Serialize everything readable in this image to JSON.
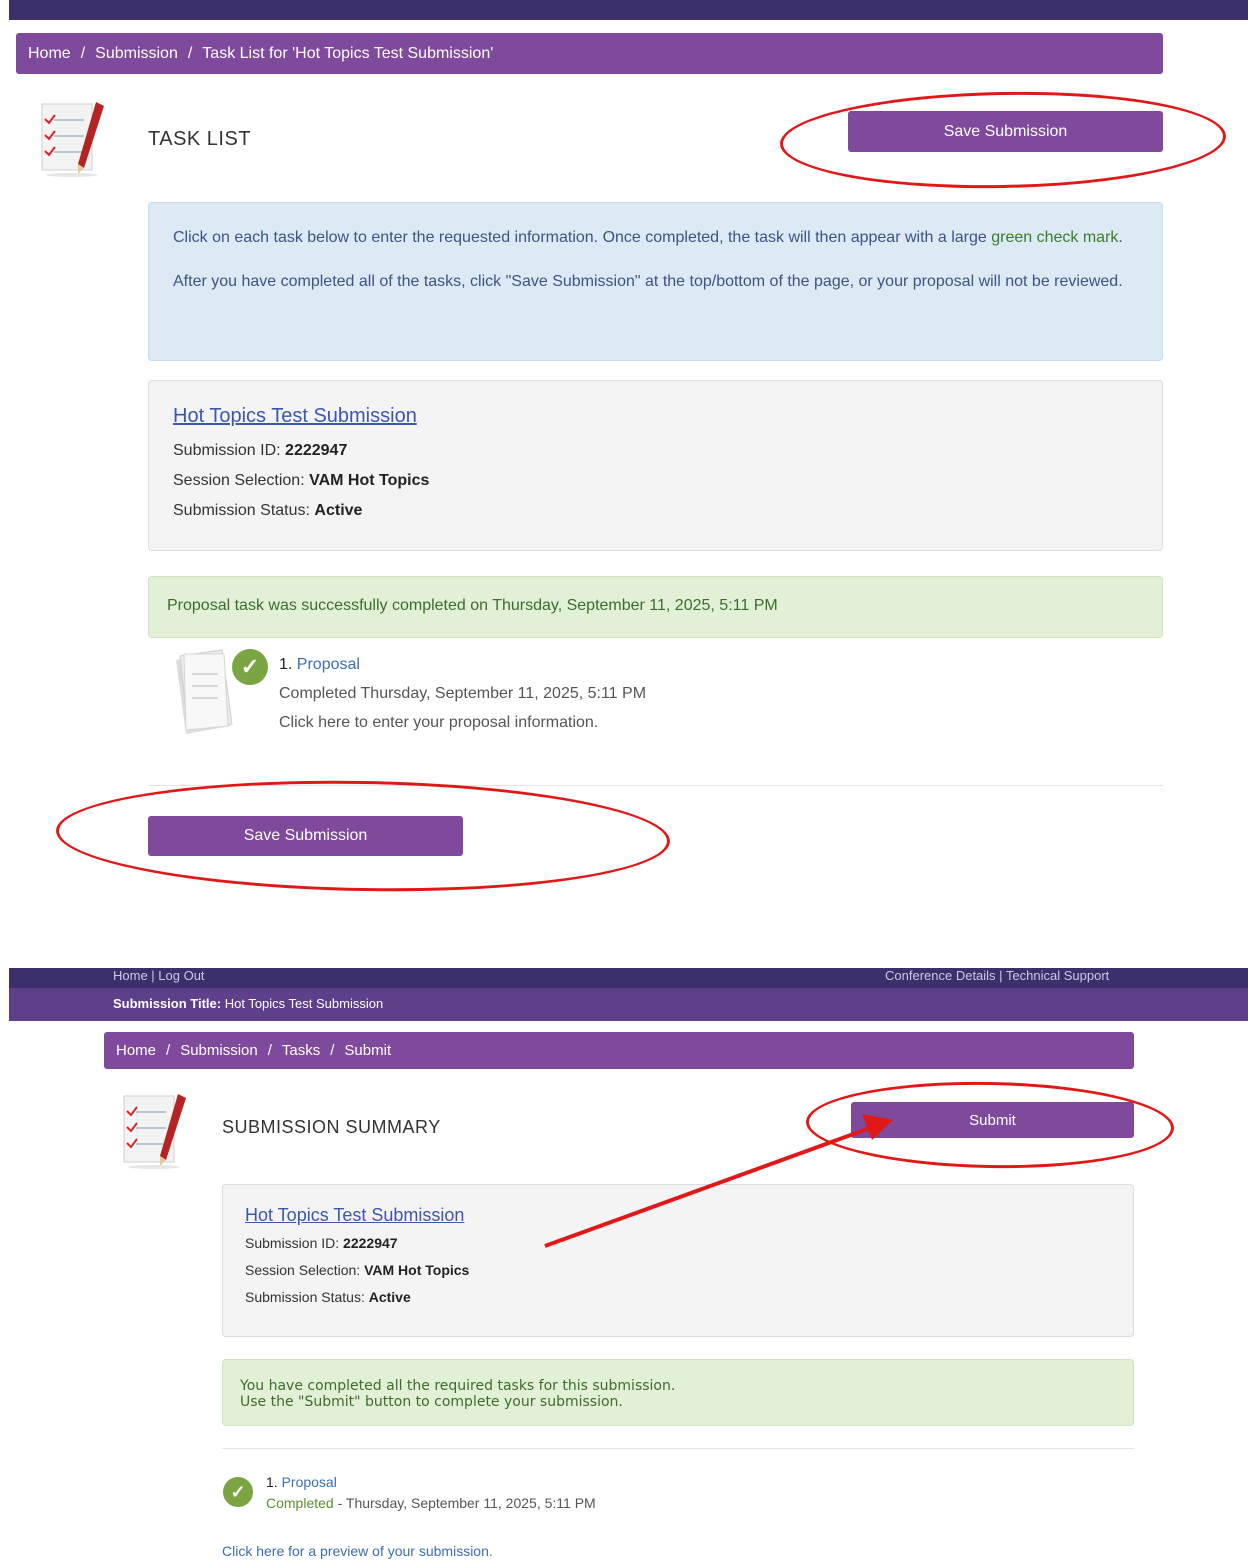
{
  "panel1": {
    "breadcrumb": [
      "Home",
      "Submission",
      "Task List for 'Hot Topics Test Submission'"
    ],
    "heading": "TASK LIST",
    "save_button": "Save Submission",
    "info": {
      "line1_a": "Click on each task below to enter the requested information. Once completed, the task will then appear with a large ",
      "line1_green": "green check mark",
      "line1_b": ".",
      "line2": "After you have completed all of the tasks, click \"Save Submission\" at the top/bottom of the page, or your proposal will not be reviewed."
    },
    "submission": {
      "title": "Hot Topics Test Submission",
      "id_label": "Submission ID: ",
      "id_value": "2222947",
      "session_label": "Session Selection: ",
      "session_value": "VAM Hot Topics",
      "status_label": "Submission Status: ",
      "status_value": "Active"
    },
    "success_message": "Proposal task was successfully completed on Thursday, September 11, 2025, 5:11 PM",
    "task": {
      "number": "1. ",
      "name": "Proposal",
      "completed": "Completed Thursday, September 11, 2025, 5:11 PM",
      "hint": "Click here to enter your proposal information."
    },
    "save_button_bottom": "Save Submission"
  },
  "panel2": {
    "top_left": "Home  |  Log Out",
    "top_right": "Conference Details  |  Technical Support",
    "submission_title_label": "Submission Title: ",
    "submission_title_value": "Hot Topics Test Submission",
    "breadcrumb": [
      "Home",
      "Submission",
      "Tasks",
      "Submit"
    ],
    "heading": "SUBMISSION SUMMARY",
    "submit_button": "Submit",
    "submission": {
      "title": "Hot Topics Test Submission",
      "id_label": "Submission ID: ",
      "id_value": "2222947",
      "session_label": "Session Selection: ",
      "session_value": "VAM Hot Topics",
      "status_label": "Submission Status: ",
      "status_value": "Active"
    },
    "success_line1": "You have completed all the required tasks for this submission.",
    "success_line2": "Use the \"Submit\" button to complete your submission.",
    "task": {
      "number": "1. ",
      "name": "Proposal",
      "status": "Completed",
      "date": " - Thursday, September 11, 2025, 5:11 PM"
    },
    "preview_link": "Click here for a preview of your submission."
  },
  "colors": {
    "purple": "#7f4a9b",
    "dark_purple": "#3d2f6b",
    "annotation_red": "#e01818",
    "check_green": "#7ba542"
  },
  "icons": [
    "checklist-icon",
    "document-stack-icon",
    "check-circle-icon"
  ]
}
